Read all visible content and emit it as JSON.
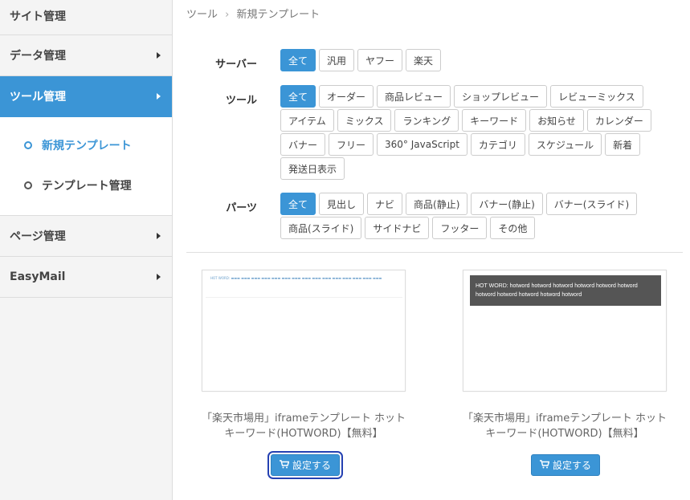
{
  "sidebar": {
    "items": [
      {
        "label": "サイト管理"
      },
      {
        "label": "データ管理"
      },
      {
        "label": "ツール管理"
      },
      {
        "label": "ページ管理"
      },
      {
        "label": "EasyMail"
      }
    ],
    "submenu": [
      {
        "label": "新規テンプレート"
      },
      {
        "label": "テンプレート管理"
      }
    ]
  },
  "breadcrumb": {
    "root": "ツール",
    "sep": "›",
    "current": "新規テンプレート"
  },
  "filters": {
    "server": {
      "label": "サーバー",
      "options": [
        "全て",
        "汎用",
        "ヤフー",
        "楽天"
      ]
    },
    "tool": {
      "label": "ツール",
      "options": [
        "全て",
        "オーダー",
        "商品レビュー",
        "ショップレビュー",
        "レビューミックス",
        "アイテム",
        "ミックス",
        "ランキング",
        "キーワード",
        "お知らせ",
        "カレンダー",
        "バナー",
        "フリー",
        "360° JavaScript",
        "カテゴリ",
        "スケジュール",
        "新着",
        "発送日表示"
      ]
    },
    "parts": {
      "label": "パーツ",
      "options": [
        "全て",
        "見出し",
        "ナビ",
        "商品(静止)",
        "バナー(静止)",
        "バナー(スライド)",
        "商品(スライド)",
        "サイドナビ",
        "フッター",
        "その他"
      ]
    }
  },
  "cards": [
    {
      "preview": "HOT WORD: ▬▬▬ ▬▬▬ ▬▬▬ ▬▬▬ ▬▬▬ ▬▬▬ ▬▬▬ ▬▬▬ ▬▬▬ ▬▬▬ ▬▬▬ ▬▬▬ ▬▬▬ ▬▬▬ ▬▬▬",
      "title": "「楽天市場用」iframeテンプレート ホットキーワード(HOTWORD)【無料】",
      "button": "設定する"
    },
    {
      "preview": "HOT WORD:  hotword hotword hotword hotword hotword hotword hotword hotword hotword hotword hotword",
      "title": "「楽天市場用」iframeテンプレート ホットキーワード(HOTWORD)【無料】",
      "button": "設定する"
    }
  ],
  "colors": {
    "accent": "#3b95d6",
    "focus": "#2541b2"
  }
}
